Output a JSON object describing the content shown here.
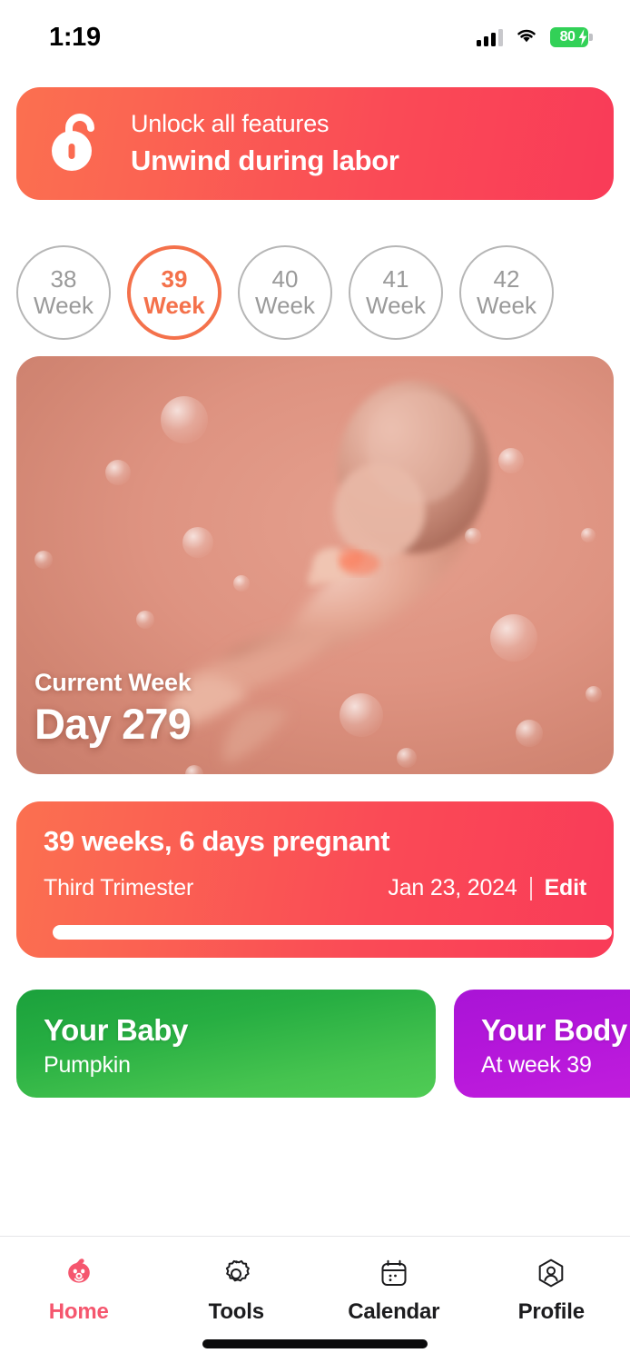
{
  "status_bar": {
    "time": "1:19",
    "signal_icon": "cellular-signal-icon",
    "wifi_icon": "wifi-icon",
    "battery_level": "80",
    "battery_icon": "battery-charging-icon",
    "battery_color": "#32D157"
  },
  "promo_banner": {
    "icon": "unlock-padlock-icon",
    "subtitle": "Unlock all features",
    "title": "Unwind during labor",
    "gradient_from": "#FB7050",
    "gradient_to": "#F93B58"
  },
  "week_selector": {
    "accent_color": "#F4714B",
    "inactive_color": "#9a9a9a",
    "weeks": [
      {
        "number": "38",
        "label": "Week",
        "selected": false
      },
      {
        "number": "39",
        "label": "Week",
        "selected": true
      },
      {
        "number": "40",
        "label": "Week",
        "selected": false
      },
      {
        "number": "41",
        "label": "Week",
        "selected": false
      },
      {
        "number": "42",
        "label": "Week",
        "selected": false
      }
    ]
  },
  "hero": {
    "image_alt": "fetus-illustration",
    "caption": "Current Week",
    "day": "Day 279"
  },
  "info_card": {
    "title": "39 weeks, 6 days pregnant",
    "trimester": "Third Trimester",
    "date": "Jan 23, 2024",
    "divider": "|",
    "edit_label": "Edit",
    "progress_percent": 100,
    "gradient_from": "#FB7050",
    "gradient_to": "#F93B58"
  },
  "category_cards": [
    {
      "title": "Your Baby",
      "subtitle": "Pumpkin",
      "color": "#27AE42",
      "name": "your-baby-card"
    },
    {
      "title": "Your Body",
      "subtitle": "At week 39",
      "color": "#B517DA",
      "name": "your-body-card"
    }
  ],
  "bottom_nav": {
    "active_color": "#F5566E",
    "items": [
      {
        "label": "Home",
        "icon": "baby-face-icon",
        "active": true
      },
      {
        "label": "Tools",
        "icon": "gear-icon",
        "active": false
      },
      {
        "label": "Calendar",
        "icon": "calendar-icon",
        "active": false
      },
      {
        "label": "Profile",
        "icon": "person-hexagon-icon",
        "active": false
      }
    ]
  }
}
